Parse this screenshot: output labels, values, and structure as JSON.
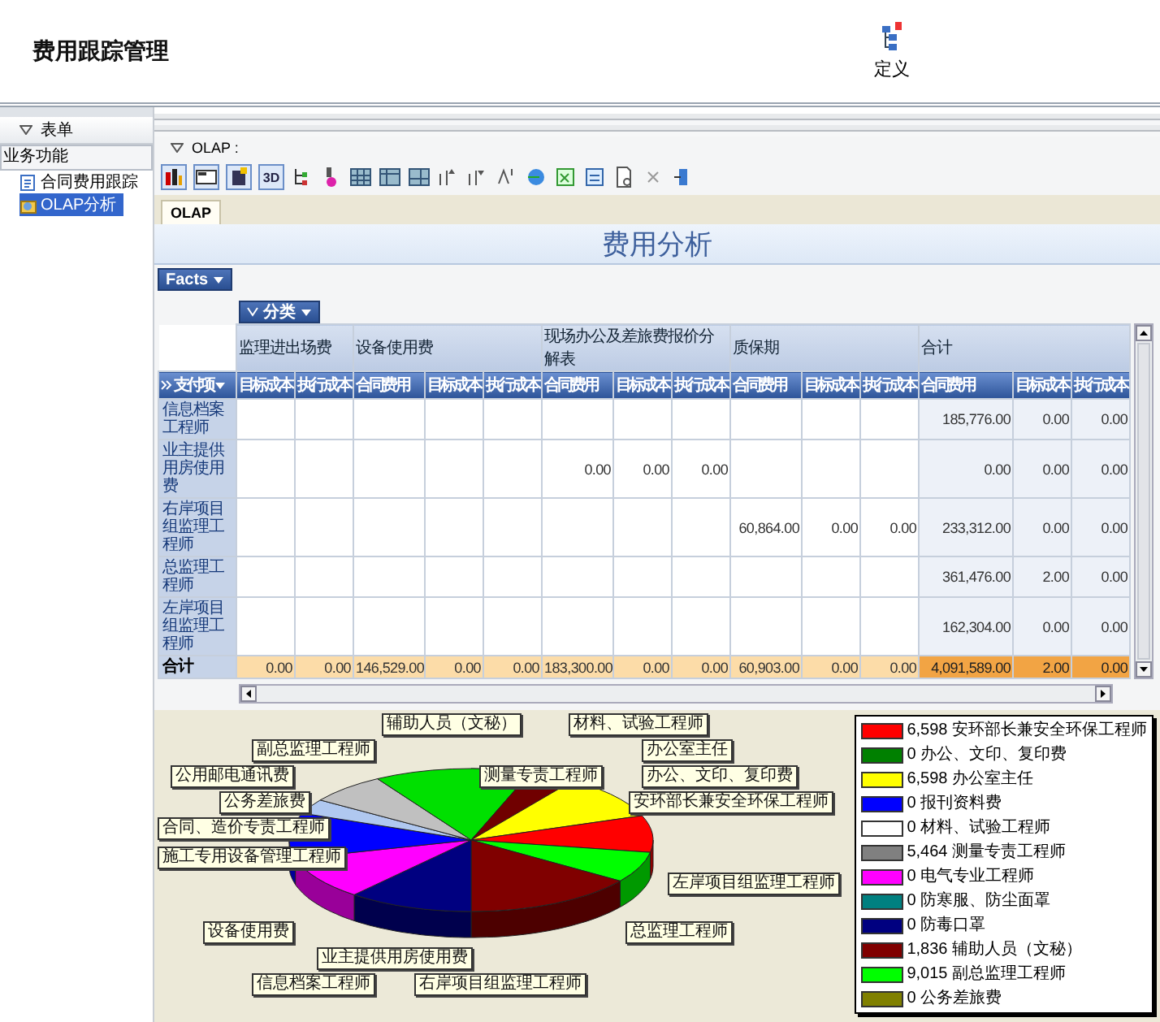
{
  "header": {
    "title": "费用跟踪管理",
    "define_button": "定义"
  },
  "sidebar": {
    "section": "表单",
    "group": "业务功能",
    "items": [
      {
        "label": "合同费用跟踪",
        "selected": false
      },
      {
        "label": "OLAP分析",
        "selected": true
      }
    ]
  },
  "toolbar": {
    "label": "OLAP :",
    "text_button": "3D"
  },
  "tabs": [
    {
      "label": "OLAP",
      "selected": true
    }
  ],
  "report": {
    "title": "费用分析",
    "facts_button": "Facts",
    "column_dimension": "分类",
    "row_dimension": "支付项",
    "column_groups": [
      {
        "label": "监理进出场费",
        "columns": [
          "目标成本",
          "执行成本"
        ]
      },
      {
        "label": "设备使用费",
        "columns": [
          "合同费用",
          "目标成本",
          "执行成本"
        ]
      },
      {
        "label": "现场办公及差旅费报价分解表",
        "columns": [
          "合同费用",
          "目标成本",
          "执行成本"
        ]
      },
      {
        "label": "质保期",
        "columns": [
          "合同费用",
          "目标成本",
          "执行成本"
        ]
      },
      {
        "label": "合计",
        "columns": [
          "合同费用",
          "目标成本",
          "执行成本"
        ]
      }
    ],
    "rows": [
      {
        "label": "信息档案工程师",
        "cells": [
          null,
          null,
          null,
          null,
          null,
          null,
          null,
          null,
          null,
          null,
          null,
          "185,776.00",
          "0.00",
          "0.00"
        ]
      },
      {
        "label": "业主提供用房使用费",
        "cells": [
          null,
          null,
          null,
          null,
          null,
          "0.00",
          "0.00",
          "0.00",
          null,
          null,
          null,
          "0.00",
          "0.00",
          "0.00"
        ]
      },
      {
        "label": "右岸项目组监理工程师",
        "cells": [
          null,
          null,
          null,
          null,
          null,
          null,
          null,
          null,
          "60,864.00",
          "0.00",
          "0.00",
          "233,312.00",
          "0.00",
          "0.00"
        ]
      },
      {
        "label": "总监理工程师",
        "cells": [
          null,
          null,
          null,
          null,
          null,
          null,
          null,
          null,
          null,
          null,
          null,
          "361,476.00",
          "2.00",
          "0.00"
        ]
      },
      {
        "label": "左岸项目组监理工程师",
        "cells": [
          null,
          null,
          null,
          null,
          null,
          null,
          null,
          null,
          null,
          null,
          null,
          "162,304.00",
          "0.00",
          "0.00"
        ]
      }
    ],
    "total_row": {
      "label": "合计",
      "cells": [
        "0.00",
        "0.00",
        "146,529.00",
        "0.00",
        "0.00",
        "183,300.00",
        "0.00",
        "0.00",
        "60,903.00",
        "0.00",
        "0.00",
        "4,091,589.00",
        "2.00",
        "0.00"
      ]
    }
  },
  "chart": {
    "slice_labels": [
      "辅助人员（文秘）",
      "材料、试验工程师",
      "副总监理工程师",
      "办公室主任",
      "公用邮电通讯费",
      "测量专责工程师",
      "办公、文印、复印费",
      "公务差旅费",
      "安环部长兼安全环保工程师",
      "合同、造价专责工程师",
      "施工专用设备管理工程师",
      "左岸项目组监理工程师",
      "设备使用费",
      "总监理工程师",
      "业主提供用房使用费",
      "信息档案工程师",
      "右岸项目组监理工程师"
    ],
    "legend": [
      {
        "color": "#ff0000",
        "label": "6,598 安环部长兼安全环保工程师"
      },
      {
        "color": "#008000",
        "label": "0 办公、文印、复印费"
      },
      {
        "color": "#ffff00",
        "label": "6,598 办公室主任"
      },
      {
        "color": "#0000ff",
        "label": "0 报刊资料费"
      },
      {
        "color": "#ffffff",
        "label": "0 材料、试验工程师"
      },
      {
        "color": "#808080",
        "label": "5,464 测量专责工程师"
      },
      {
        "color": "#ff00ff",
        "label": "0 电气专业工程师"
      },
      {
        "color": "#008080",
        "label": "0 防寒服、防尘面罩"
      },
      {
        "color": "#000080",
        "label": "0 防毒口罩"
      },
      {
        "color": "#800000",
        "label": "1,836 辅助人员（文秘）"
      },
      {
        "color": "#00ff00",
        "label": "9,015 副总监理工程师"
      },
      {
        "color": "#808000",
        "label": "0 公务差旅费"
      }
    ]
  }
}
